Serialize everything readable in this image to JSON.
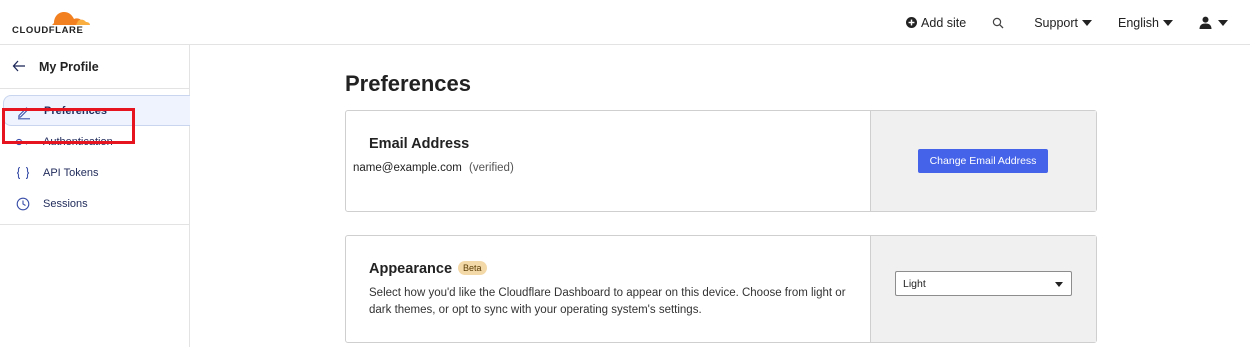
{
  "brand": {
    "name": "CLOUDFLARE",
    "accent": "#f38020",
    "accent_light": "#faae40"
  },
  "topnav": {
    "add_site": "Add site",
    "support": "Support",
    "language": "English",
    "icons": [
      "plus-circle-icon",
      "search-icon",
      "user-icon"
    ]
  },
  "sidebar": {
    "back_icon": "arrow-left-icon",
    "title": "My Profile",
    "items": [
      {
        "label": "Preferences",
        "icon": "pencil-icon",
        "active": true
      },
      {
        "label": "Authentication",
        "icon": "key-icon",
        "active": false
      },
      {
        "label": "API Tokens",
        "icon": "braces-icon",
        "active": false,
        "highlighted": true
      },
      {
        "label": "Sessions",
        "icon": "clock-icon",
        "active": false
      }
    ]
  },
  "main": {
    "title": "Preferences",
    "email_card": {
      "heading": "Email Address",
      "email": "name@example.com",
      "status": "(verified)",
      "button": "Change Email Address"
    },
    "appearance_card": {
      "heading": "Appearance",
      "badge": "Beta",
      "description": "Select how you'd like the Cloudflare Dashboard to appear on this device. Choose from light or dark themes, or opt to sync with your operating system's settings.",
      "select_value": "Light"
    }
  },
  "colors": {
    "primary_button": "#4563e8",
    "highlight_border": "#e5141e",
    "active_bg": "#eef3fd"
  }
}
